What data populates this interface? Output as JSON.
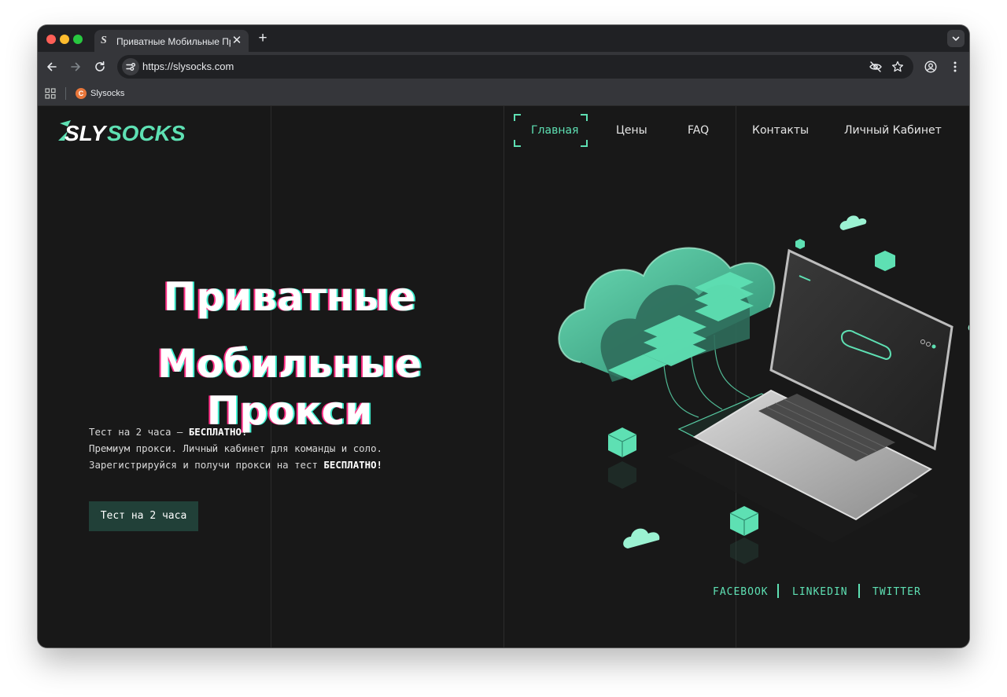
{
  "browser": {
    "tab": {
      "title": "Приватные Мобильные Прокси",
      "favicon_icon": "slysocks-s-logo-icon",
      "favicon_glyph": "S"
    },
    "url": "https://slysocks.com",
    "bookmarks": [
      {
        "label": "Slysocks",
        "favicon_glyph": "C"
      }
    ]
  },
  "site": {
    "logo": {
      "part1": "SLY",
      "part2": "SOCKS"
    },
    "nav": [
      {
        "label": "Главная",
        "active": true
      },
      {
        "label": "Цены",
        "active": false
      },
      {
        "label": "FAQ",
        "active": false
      },
      {
        "label": "Контакты",
        "active": false
      },
      {
        "label": "Личный Кабинет",
        "active": false
      }
    ],
    "hero": {
      "title_line1": "Приватные",
      "title_line2": "Мобильные Прокси",
      "line1_text": "Тест на 2 часа – ",
      "line1_bold": "БЕСПЛАТНО!",
      "line2_text": "Премиум прокси. Личный кабинет для команды и соло.",
      "line3_text": "Зарегистрируйся и получи прокси на тест ",
      "line3_bold": "БЕСПЛАТНО!",
      "cta_label": "Тест на 2 часа"
    },
    "social": [
      "FACEBOOK",
      "LINKEDIN",
      "TWITTER"
    ]
  },
  "colors": {
    "accent": "#5ee0b3",
    "page_bg": "#181818",
    "cta_bg": "#214038",
    "glitch_pink": "#ff2f86",
    "glitch_cyan": "#3ff0d0"
  }
}
